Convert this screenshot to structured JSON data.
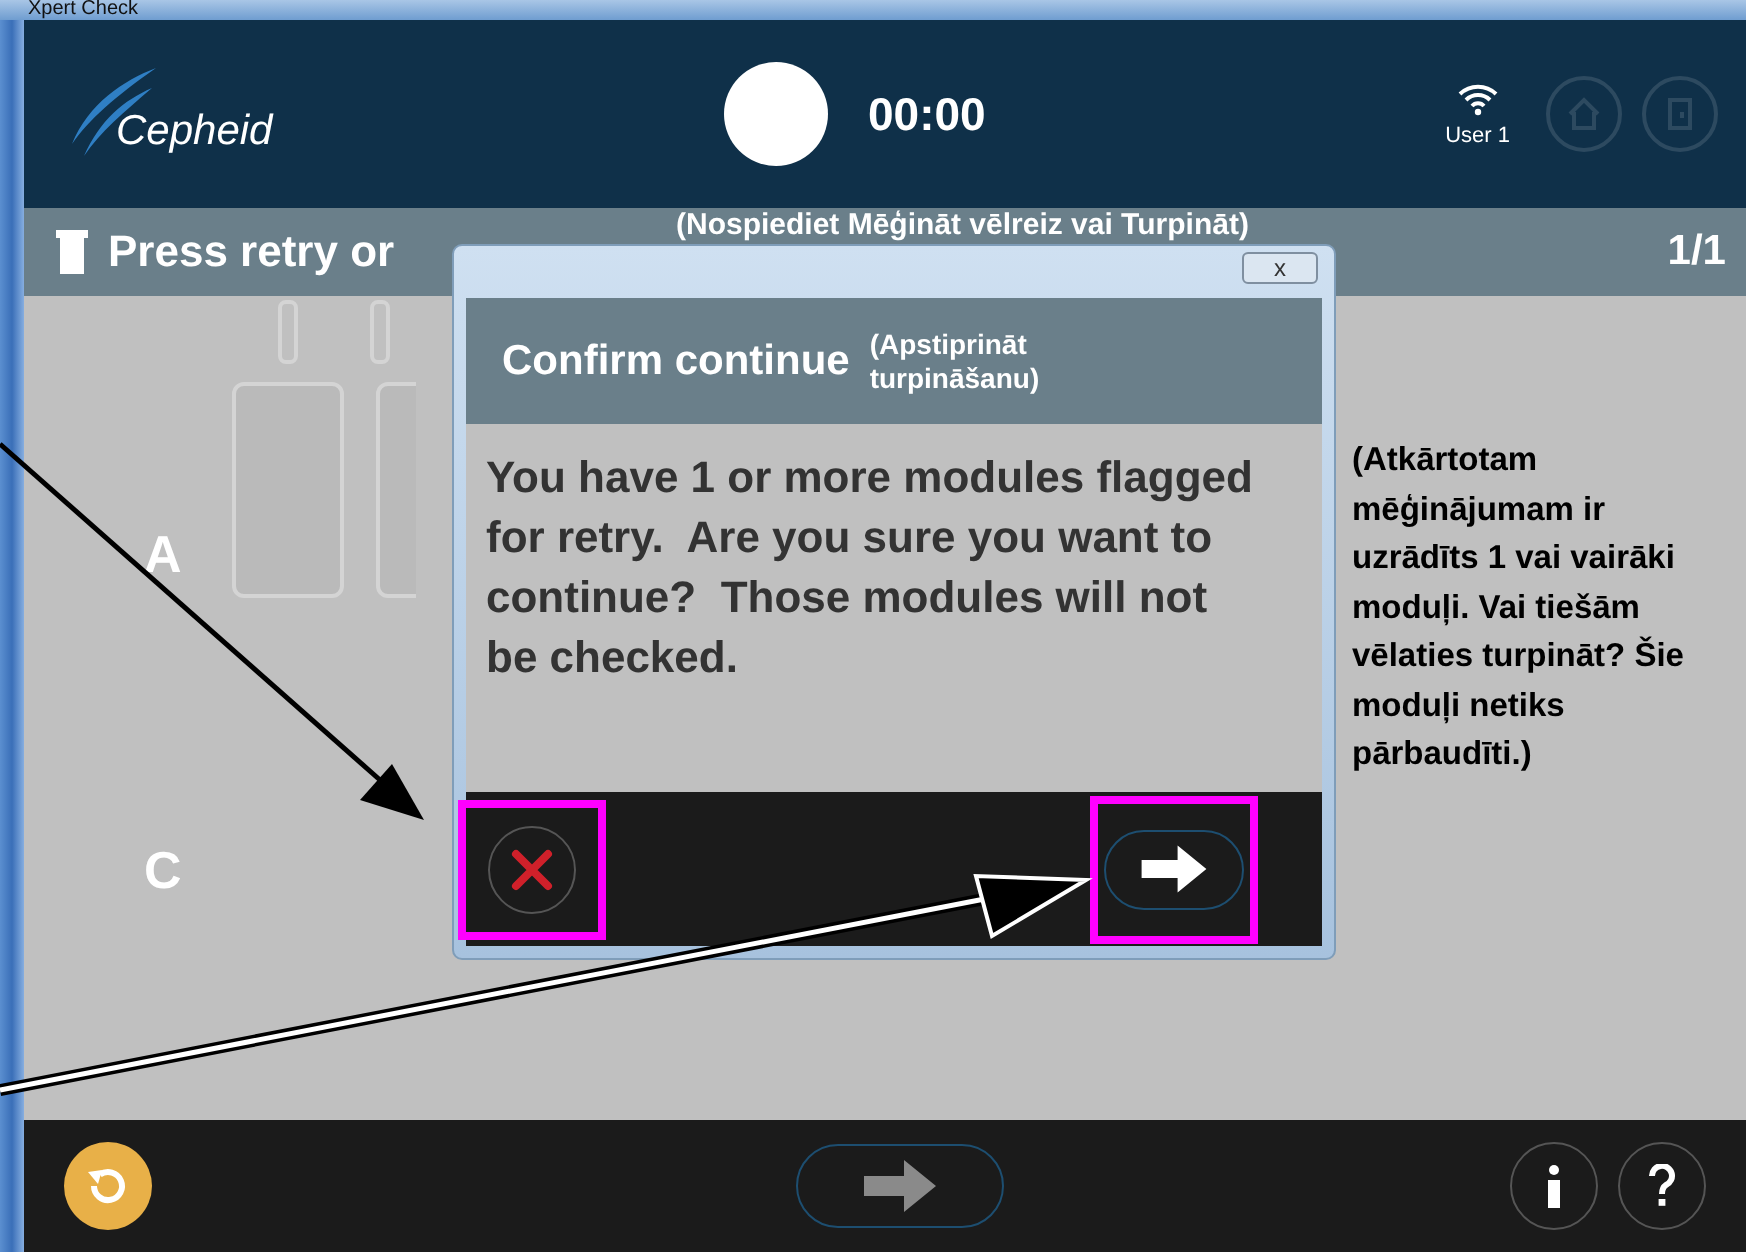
{
  "window": {
    "title": "Xpert Check"
  },
  "header": {
    "brand": "Cepheid",
    "timer": "00:00",
    "user": "User 1"
  },
  "subbar": {
    "title": "Press retry or",
    "page": "1/1",
    "annotation": "(Nospiediet Mēģināt vēlreiz vai Turpināt)"
  },
  "modules": [
    {
      "label": "A"
    },
    {
      "label": "C"
    }
  ],
  "dialog": {
    "close": "x",
    "title": "Confirm continue",
    "title_annotation": "(Apstiprināt turpināšanu)",
    "message": "You have 1 or more modules flagged for retry.  Are you sure you want to continue?  Those modules will not be checked.",
    "buttons": [
      {
        "kind": "cancel",
        "highlighted": true
      },
      {
        "kind": "next",
        "highlighted": true
      }
    ]
  },
  "side_annotation": "(Atkārtotam mēģinājumam ir uzrādīts 1 vai vairāki moduļi. Vai tiešām vēlaties turpināt? Šie moduļi netiks pārbaudīti.)"
}
